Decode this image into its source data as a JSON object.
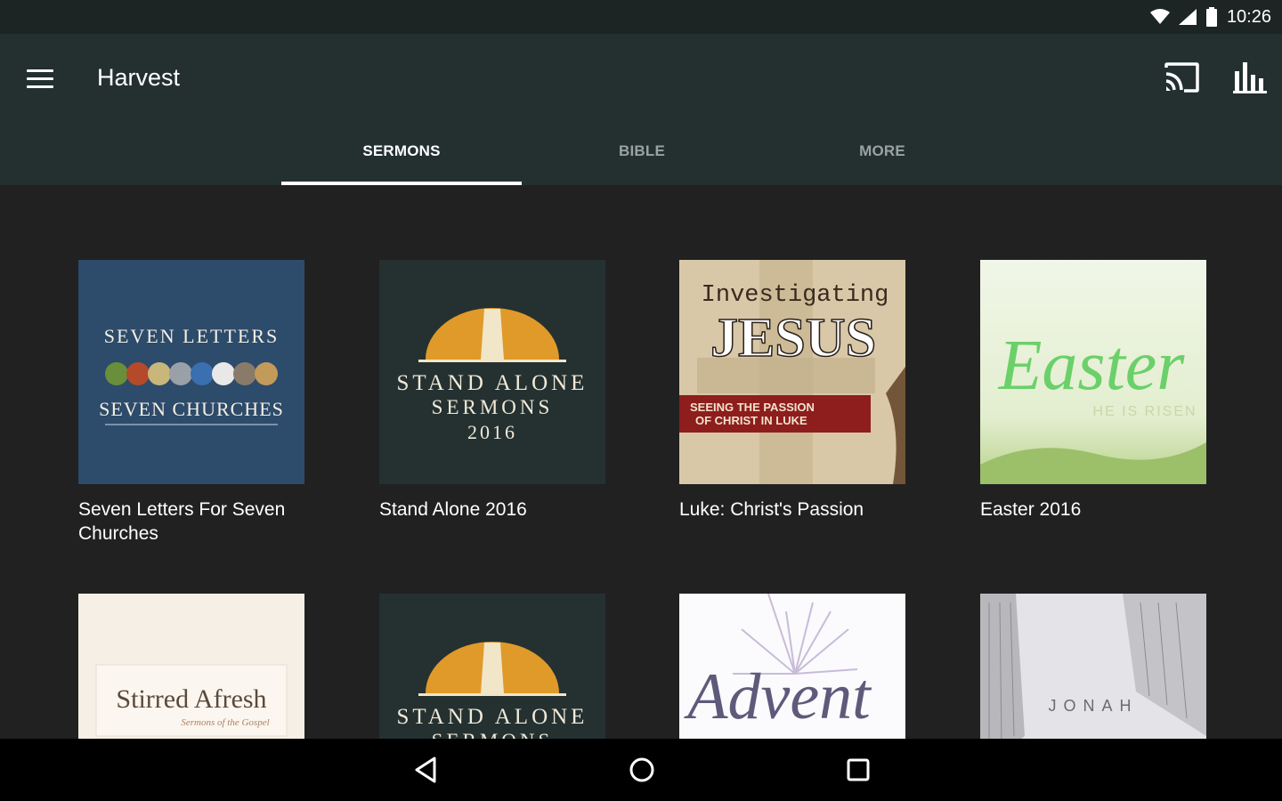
{
  "status": {
    "time": "10:26"
  },
  "app": {
    "title": "Harvest"
  },
  "tabs": [
    {
      "label": "SERMONS",
      "active": true
    },
    {
      "label": "BIBLE",
      "active": false
    },
    {
      "label": "MORE",
      "active": false
    }
  ],
  "series": [
    {
      "title": "Seven Letters For Seven Churches",
      "art": {
        "line1": "SEVEN LETTERS",
        "line2": "SEVEN CHURCHES"
      }
    },
    {
      "title": "Stand Alone 2016",
      "art": {
        "line1": "STAND ALONE",
        "line2": "SERMONS",
        "line3": "2016"
      }
    },
    {
      "title": "Luke: Christ's Passion",
      "art": {
        "line1": "Investigating",
        "line2": "JESUS",
        "line3": "SEEING THE PASSION",
        "line4": "OF CHRIST IN LUKE"
      }
    },
    {
      "title": "Easter 2016",
      "art": {
        "line1": "Easter",
        "line2": "HE IS RISEN"
      }
    },
    {
      "title": "",
      "art": {
        "line1": "Stirred Afresh",
        "line2": "Sermons of the Gospel"
      }
    },
    {
      "title": "",
      "art": {
        "line1": "STAND ALONE",
        "line2": "SERMONS"
      }
    },
    {
      "title": "",
      "art": {
        "line1": "Advent"
      }
    },
    {
      "title": "",
      "art": {
        "line1": "JONAH"
      }
    }
  ],
  "colors": {
    "status_bar": "#1c2424",
    "app_bar": "#243030",
    "background": "#212121",
    "accent_orange": "#e09a2a"
  },
  "icons": {
    "menu": "menu-icon",
    "cast": "cast-icon",
    "stats": "bar-chart-icon",
    "back": "back-icon",
    "home": "home-icon",
    "recents": "recents-icon"
  }
}
